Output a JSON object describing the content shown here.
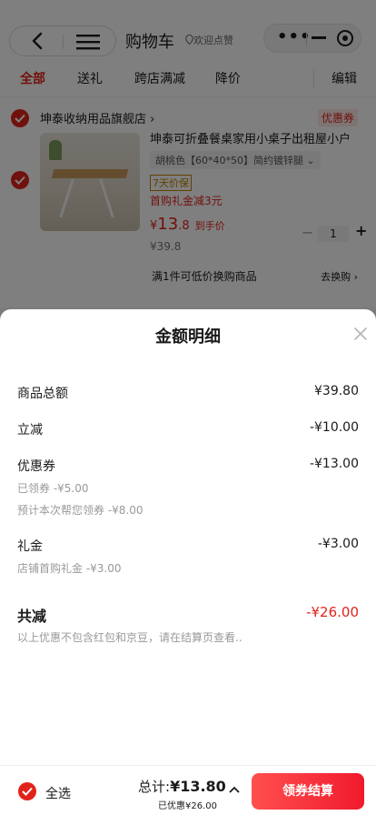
{
  "header": {
    "title": "购物车",
    "favorite_label": "欢迎点赞",
    "capsule_more": "•••"
  },
  "tabs": [
    {
      "label": "全部",
      "active": true
    },
    {
      "label": "送礼"
    },
    {
      "label": "跨店满减"
    },
    {
      "label": "降价"
    },
    {
      "label": "编辑"
    }
  ],
  "cart": {
    "shop_name": "坤泰收纳用品旗舰店 ›",
    "coupon_tag": "优惠券",
    "product_title": "坤泰可折叠餐桌家用小桌子出租屋小户",
    "spec": "胡桃色【60*40*50】简约镀锌腿 ⌄",
    "service_tag": "7天价保",
    "gift_text": "首购礼金减3元",
    "price_currency": "¥",
    "price_int": "13",
    "price_dec": ".8",
    "price_after": "到手价",
    "original_price": "¥39.8",
    "qty_minus": "−",
    "qty": "1",
    "qty_plus": "+",
    "promo_text": "满1件可低价换购商品",
    "promo_link": "去换购 ›"
  },
  "sheet": {
    "title": "金额明细",
    "rows": [
      {
        "label": "商品总额",
        "value": "¥39.80"
      },
      {
        "label": "立减",
        "value": "-¥10.00"
      },
      {
        "label": "优惠券",
        "value": "-¥13.00",
        "subs": [
          "已领券 -¥5.00",
          "预计本次帮您领券 -¥8.00"
        ]
      },
      {
        "label": "礼金",
        "value": "-¥3.00",
        "subs": [
          "店铺首购礼金 -¥3.00"
        ]
      }
    ],
    "total_label": "共减",
    "total_value": "-¥26.00",
    "note": "以上优惠不包含红包和京豆，请在结算页查看.."
  },
  "checkout": {
    "select_all": "全选",
    "total_prefix": "总计:",
    "total_amount": "¥13.80",
    "saved": "已优惠¥26.00",
    "button": "领券结算"
  },
  "colors": {
    "accent": "#e2231a",
    "button_gradient_start": "#ff4f4f",
    "button_gradient_end": "#f01a2c"
  }
}
